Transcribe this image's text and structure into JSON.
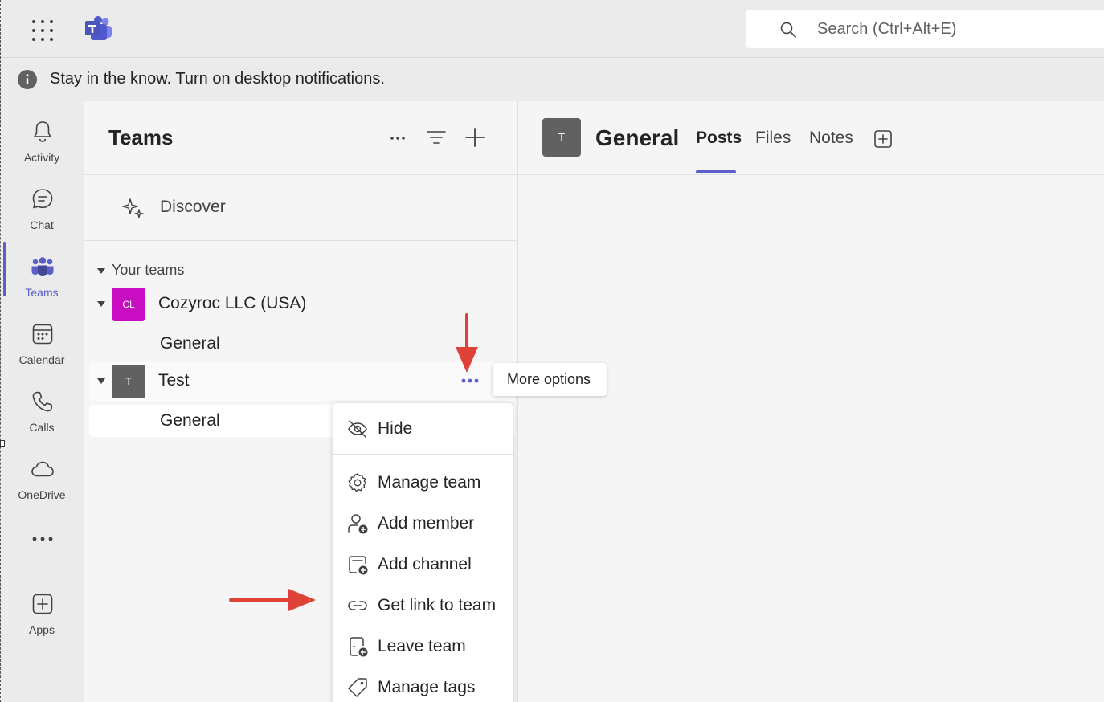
{
  "search": {
    "placeholder": "Search (Ctrl+Alt+E)"
  },
  "notification": {
    "text": "Stay in the know. Turn on desktop notifications."
  },
  "app_bar": {
    "items": [
      {
        "label": "Activity",
        "icon": "bell-icon"
      },
      {
        "label": "Chat",
        "icon": "chat-icon"
      },
      {
        "label": "Teams",
        "icon": "teams-icon"
      },
      {
        "label": "Calendar",
        "icon": "calendar-icon"
      },
      {
        "label": "Calls",
        "icon": "phone-icon"
      },
      {
        "label": "OneDrive",
        "icon": "cloud-icon"
      },
      {
        "label": "Apps",
        "icon": "add-app-icon"
      }
    ],
    "active": "Teams"
  },
  "teams_panel": {
    "title": "Teams",
    "discover_label": "Discover",
    "section_label": "Your teams",
    "teams": [
      {
        "initials": "CL",
        "name": "Cozyroc LLC (USA)",
        "color": "#c90dc2",
        "channels": [
          "General"
        ]
      },
      {
        "initials": "T",
        "name": "Test",
        "color": "#616161",
        "channels": [
          "General"
        ]
      }
    ]
  },
  "tooltip": {
    "text": "More options"
  },
  "context_menu": {
    "items": [
      {
        "label": "Hide",
        "icon": "hide-icon"
      },
      {
        "label": "Manage team",
        "icon": "gear-icon"
      },
      {
        "label": "Add member",
        "icon": "add-member-icon"
      },
      {
        "label": "Add channel",
        "icon": "add-channel-icon"
      },
      {
        "label": "Get link to team",
        "icon": "link-icon"
      },
      {
        "label": "Leave team",
        "icon": "leave-icon"
      },
      {
        "label": "Manage tags",
        "icon": "tag-icon"
      }
    ]
  },
  "channel_header": {
    "avatar_initials": "T",
    "title": "General",
    "tabs": [
      "Posts",
      "Files",
      "Notes"
    ],
    "active_tab": "Posts"
  },
  "colors": {
    "accent": "#5b5fc7",
    "annotation_arrow": "#e0423a"
  }
}
